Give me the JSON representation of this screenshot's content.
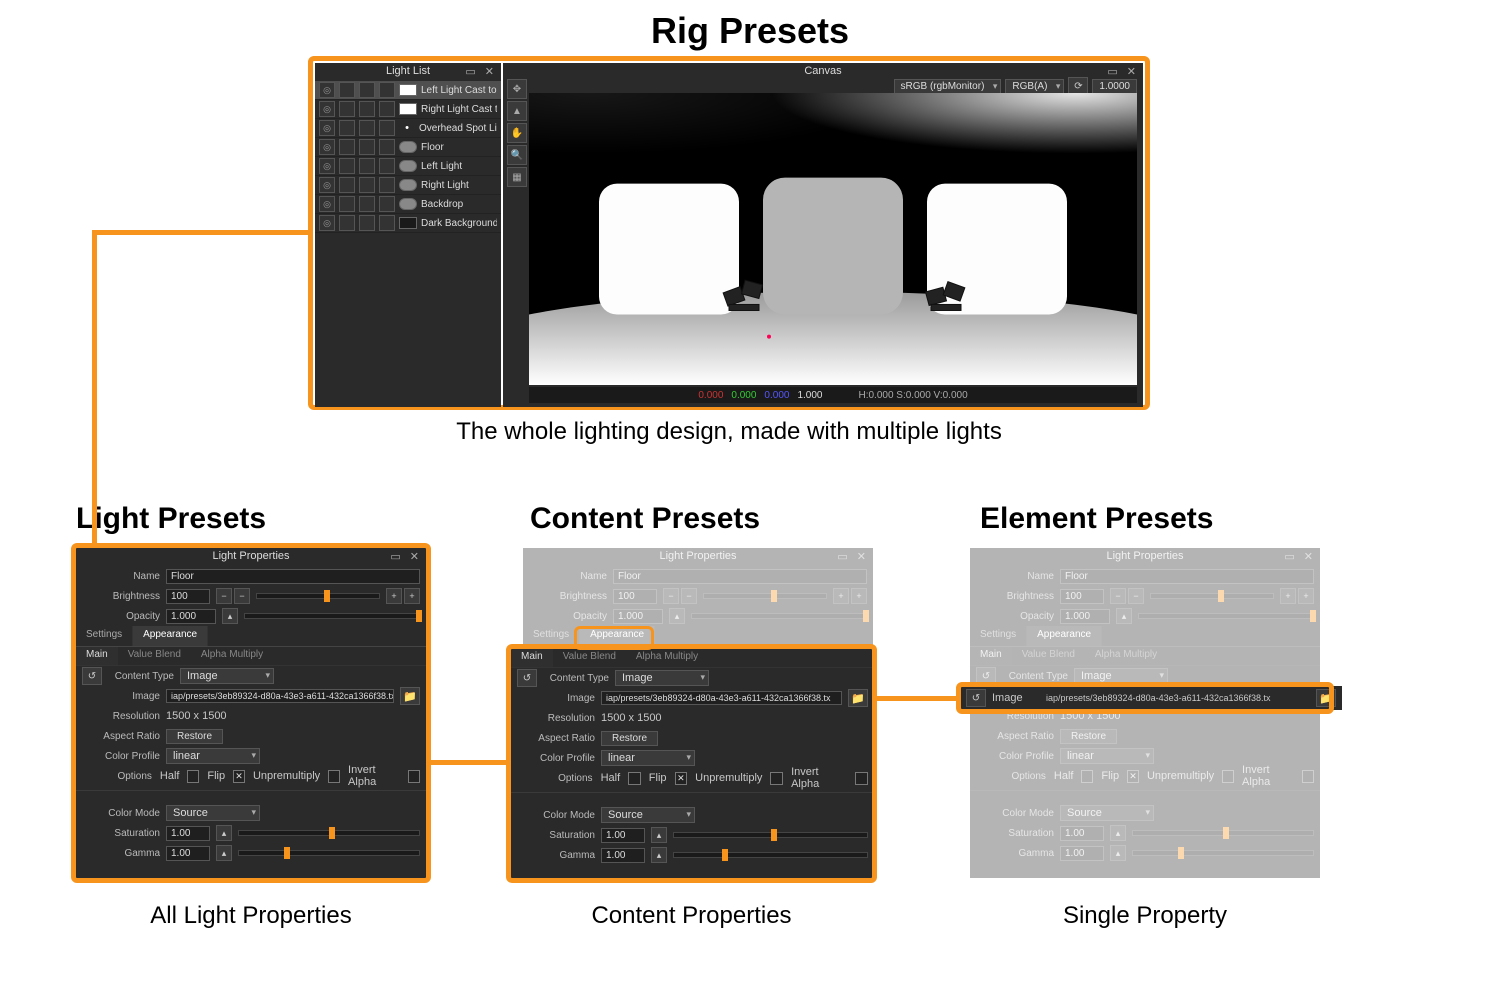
{
  "headings": {
    "rig": "Rig Presets",
    "light": "Light Presets",
    "content": "Content Presets",
    "element": "Element Presets"
  },
  "captions": {
    "rig": "The whole lighting design, made with multiple lights",
    "light": "All Light Properties",
    "content": "Content Properties",
    "element": "Single Property"
  },
  "lightList": {
    "title": "Light List",
    "items": [
      {
        "swatch": "#ffffff",
        "label": "Left Light Cast to Floor",
        "selected": true
      },
      {
        "swatch": "#ffffff",
        "label": "Right Light Cast to Floor"
      },
      {
        "swatch": "#ffffff",
        "label": "Overhead Spot Light",
        "dot": true
      },
      {
        "swatch": "#888888",
        "label": "Floor",
        "round": true
      },
      {
        "swatch": "#888888",
        "label": "Left Light",
        "round": true
      },
      {
        "swatch": "#888888",
        "label": "Right Light",
        "round": true
      },
      {
        "swatch": "#888888",
        "label": "Backdrop",
        "round": true
      },
      {
        "swatch": "#1a1a1a",
        "label": "Dark Background"
      }
    ]
  },
  "canvas": {
    "title": "Canvas",
    "colorspace": "sRGB (rgbMonitor)",
    "channels": "RGB(A)",
    "exposure": "1.0000",
    "status": {
      "r": "0.000",
      "g": "0.000",
      "b": "0.000",
      "w": "1.000",
      "hsv": "H:0.000 S:0.000 V:0.000"
    }
  },
  "props": {
    "title": "Light Properties",
    "nameLabel": "Name",
    "nameValue": "Floor",
    "brightnessLabel": "Brightness",
    "brightnessValue": "100",
    "opacityLabel": "Opacity",
    "opacityValue": "1.000",
    "tabs": {
      "settings": "Settings",
      "appearance": "Appearance"
    },
    "subtabs": {
      "main": "Main",
      "valueBlend": "Value Blend",
      "alphaMultiply": "Alpha Multiply"
    },
    "contentTypeLabel": "Content Type",
    "contentTypeValue": "Image",
    "imageLabel": "Image",
    "imageValue": "iap/presets/3eb89324-d80a-43e3-a611-432ca1366f38.tx",
    "resolutionLabel": "Resolution",
    "resolutionValue": "1500 x 1500",
    "aspectRatioLabel": "Aspect Ratio",
    "restore": "Restore",
    "colorProfileLabel": "Color Profile",
    "colorProfileValue": "linear",
    "optionsLabel": "Options",
    "optHalf": "Half",
    "optFlip": "Flip",
    "optUnpremult": "Unpremultiply",
    "optInvertAlpha": "Invert Alpha",
    "colorModeLabel": "Color Mode",
    "colorModeValue": "Source",
    "saturationLabel": "Saturation",
    "saturationValue": "1.00",
    "gammaLabel": "Gamma",
    "gammaValue": "1.00"
  }
}
